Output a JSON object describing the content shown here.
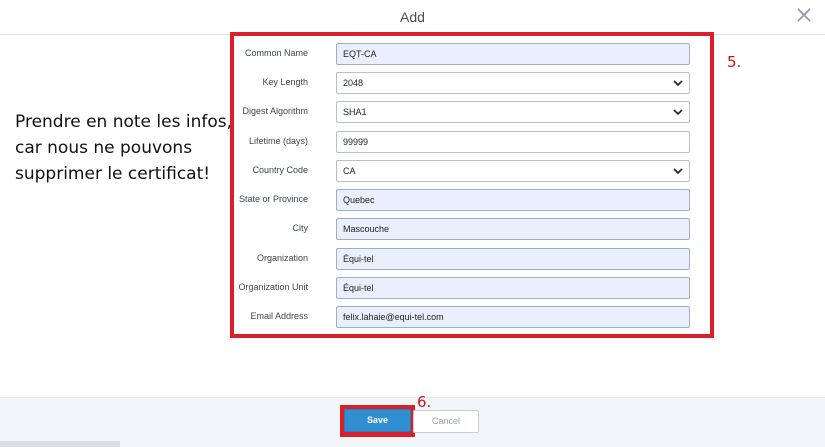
{
  "dialog": {
    "title": "Add",
    "close_icon": "close-icon"
  },
  "note": {
    "lines": [
      "Prendre en note les infos,",
      "car nous ne pouvons",
      "supprimer le certificat!"
    ]
  },
  "steps": {
    "form": "5.",
    "save": "6."
  },
  "form": {
    "fields": [
      {
        "label": "Common Name",
        "value": "EQT-CA",
        "type": "text"
      },
      {
        "label": "Key Length",
        "value": "2048",
        "type": "select"
      },
      {
        "label": "Digest Algorithm",
        "value": "SHA1",
        "type": "select"
      },
      {
        "label": "Lifetime (days)",
        "value": "99999",
        "type": "text"
      },
      {
        "label": "Country Code",
        "value": "CA",
        "type": "select"
      },
      {
        "label": "State or Province",
        "value": "Quebec",
        "type": "text"
      },
      {
        "label": "City",
        "value": "Mascouche",
        "type": "text"
      },
      {
        "label": "Organization",
        "value": "Équi-tel",
        "type": "text"
      },
      {
        "label": "Organization Unit",
        "value": "Équi-tel",
        "type": "text"
      },
      {
        "label": "Email Address",
        "value": "felix.lahaie@equi-tel.com",
        "type": "text"
      }
    ]
  },
  "footer": {
    "save_label": "Save",
    "cancel_label": "Cancel"
  },
  "colors": {
    "annotation_red": "#d9202a",
    "primary_blue": "#2f8fd0",
    "field_fill": "#e9effb"
  }
}
